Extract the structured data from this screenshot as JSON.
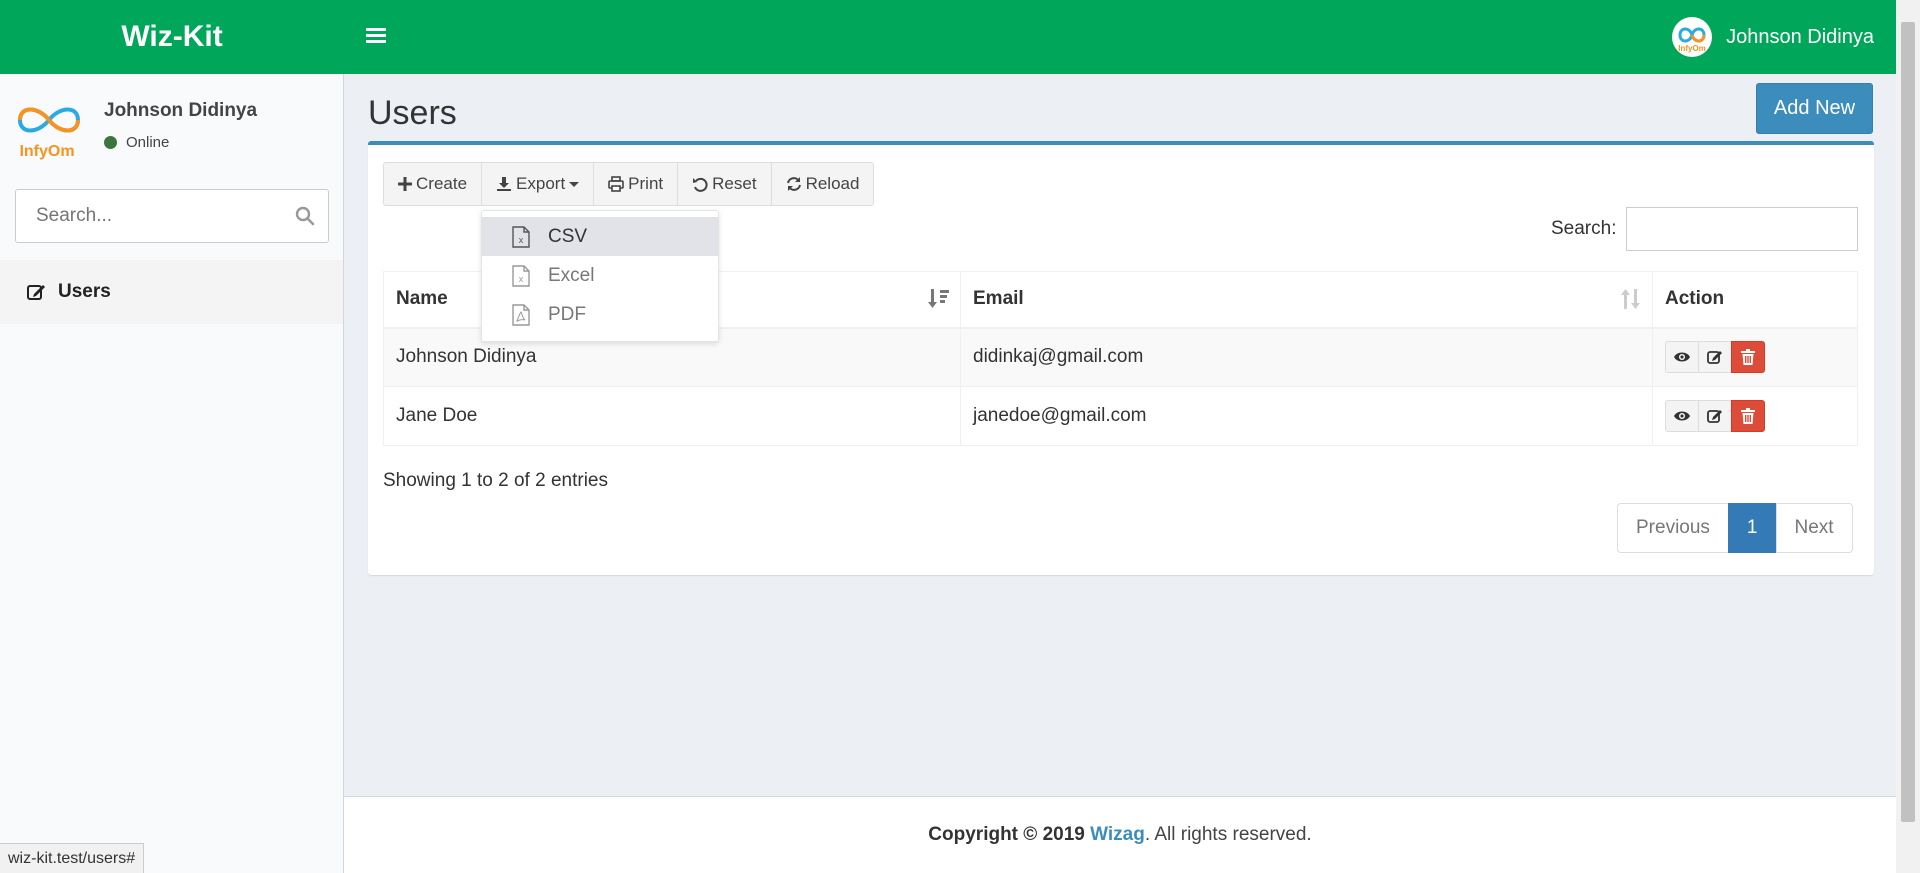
{
  "header": {
    "brand": "Wiz-Kit",
    "user_name": "Johnson Didinya",
    "bg_color": "#00a65a"
  },
  "sidebar": {
    "user_name": "Johnson Didinya",
    "logo_text": "InfyOm",
    "status": "Online",
    "search_placeholder": "Search...",
    "items": [
      {
        "label": "Users",
        "icon": "edit-icon"
      }
    ]
  },
  "main": {
    "title": "Users",
    "add_new_label": "Add New",
    "toolbar": {
      "create": "Create",
      "export": "Export",
      "print": "Print",
      "reset": "Reset",
      "reload": "Reload"
    },
    "export_menu": [
      {
        "label": "CSV"
      },
      {
        "label": "Excel"
      },
      {
        "label": "PDF"
      }
    ],
    "search_label": "Search:",
    "table": {
      "columns": [
        "Name",
        "Email",
        "Action"
      ],
      "rows": [
        {
          "name": "Johnson Didinya",
          "email": "didinkaj@gmail.com"
        },
        {
          "name": "Jane Doe",
          "email": "janedoe@gmail.com"
        }
      ]
    },
    "info": "Showing 1 to 2 of 2 entries",
    "pagination": {
      "previous": "Previous",
      "current": "1",
      "next": "Next"
    }
  },
  "footer": {
    "prefix": "Copyright © 2019",
    "brand": "Wizag",
    "suffix": ". All rights reserved."
  },
  "status_bar": {
    "url": "wiz-kit.test/users#"
  },
  "colors": {
    "accent": "#3c8dbc",
    "danger": "#dd4b39",
    "primary": "#337ab7"
  }
}
